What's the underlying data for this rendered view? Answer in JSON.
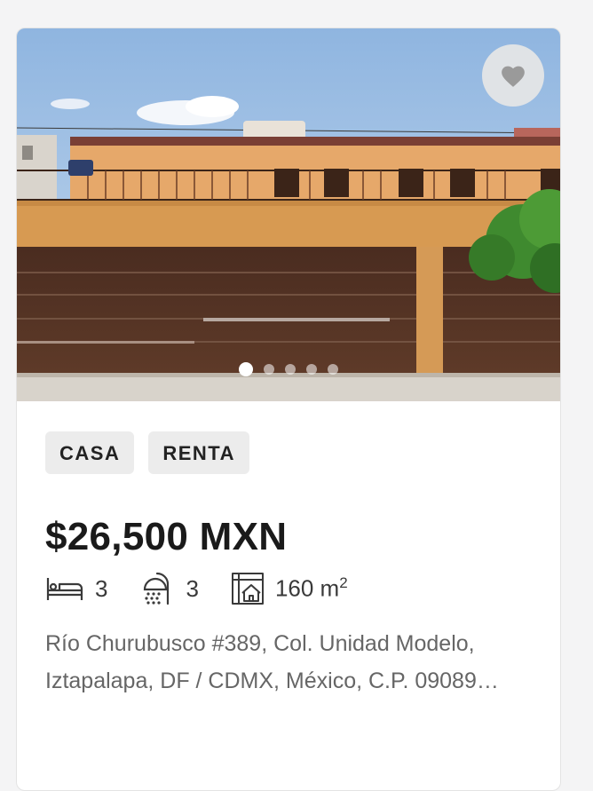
{
  "listing": {
    "tags": [
      "CASA",
      "RENTA"
    ],
    "price": "$26,500 MXN",
    "bedrooms": "3",
    "bathrooms": "3",
    "area": "160 m",
    "area_unit_exp": "2",
    "address_line1": "Río Churubusco #389, Col. Unidad Modelo,",
    "address_line2": "Iztapalapa, DF / CDMX, México, C.P. 09089…"
  },
  "gallery": {
    "photo_count": 5,
    "active_index": 0
  },
  "icons": {
    "favorite": "heart-icon",
    "bedroom": "bed-icon",
    "bathroom": "shower-icon",
    "area": "floorplan-house-icon"
  },
  "colors": {
    "tag_bg": "#ececec",
    "price_text": "#1a1a1a",
    "address_text": "#666666"
  }
}
